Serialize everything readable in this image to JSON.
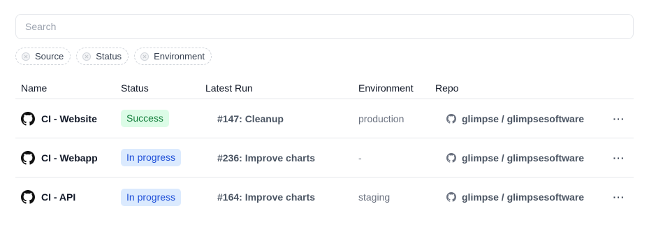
{
  "search": {
    "placeholder": "Search",
    "value": ""
  },
  "filters": [
    {
      "label": "Source",
      "icon": "plus-circle-icon"
    },
    {
      "label": "Status",
      "icon": "plus-circle-icon"
    },
    {
      "label": "Environment",
      "icon": "plus-circle-icon"
    }
  ],
  "table": {
    "headers": {
      "name": "Name",
      "status": "Status",
      "latest_run": "Latest Run",
      "environment": "Environment",
      "repo": "Repo"
    },
    "rows": [
      {
        "icon": "github-icon",
        "name": "CI - Website",
        "status": "Success",
        "status_color": "#15803d",
        "latest_run": "#147: Cleanup",
        "environment": "production",
        "repo": "glimpse / glimpsesoftware",
        "more": "···"
      },
      {
        "icon": "github-icon",
        "name": "CI - Webapp",
        "status": "In progress",
        "status_color": "#1d4ed8",
        "latest_run": "#236: Improve charts",
        "environment": "-",
        "repo": "glimpse / glimpsesoftware",
        "more": "···"
      },
      {
        "icon": "github-icon",
        "name": "CI - API",
        "status": "In progress",
        "status_color": "#1d4ed8",
        "latest_run": "#164: Improve charts",
        "environment": "staging",
        "repo": "glimpse / glimpsesoftware",
        "more": "···"
      }
    ]
  }
}
